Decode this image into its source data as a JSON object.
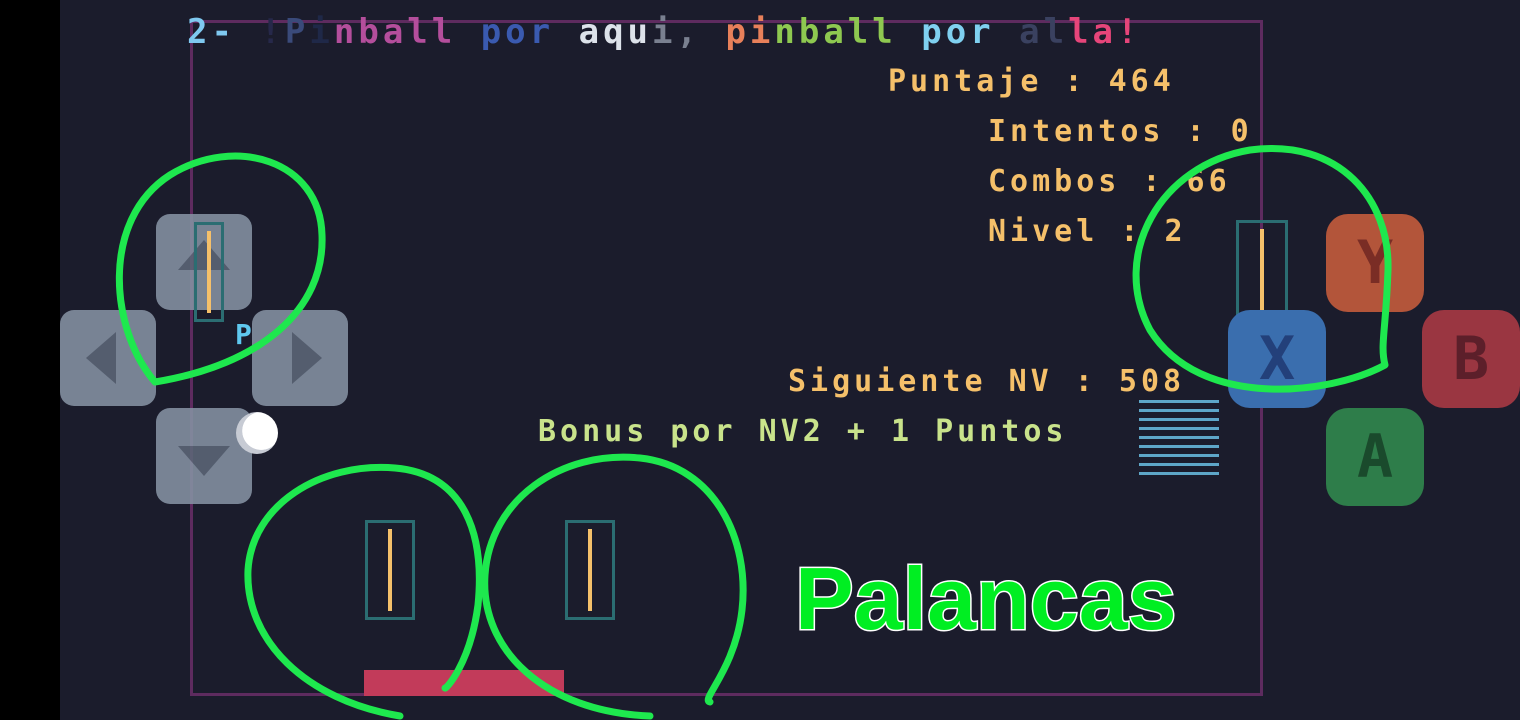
{
  "title": {
    "parts": [
      {
        "text": "2- ",
        "color": "#7fc8f0"
      },
      {
        "text": "!",
        "color": "#26284a"
      },
      {
        "text": "P",
        "color": "#3a4a7a"
      },
      {
        "text": "i",
        "color": "#1f2848"
      },
      {
        "text": "nball ",
        "color": "#b44e9c"
      },
      {
        "text": "por ",
        "color": "#3a5ab0"
      },
      {
        "text": "aqu",
        "color": "#dde2ea"
      },
      {
        "text": "i, ",
        "color": "#7a8090"
      },
      {
        "text": "pi",
        "color": "#e8805a"
      },
      {
        "text": "nball ",
        "color": "#8ec850"
      },
      {
        "text": "por ",
        "color": "#7fd0f0"
      },
      {
        "text": "al",
        "color": "#3a4160"
      },
      {
        "text": "la!",
        "color": "#e6457a"
      }
    ]
  },
  "hud": {
    "score": "Puntaje : 464",
    "attempts": "Intentos : 0",
    "combos": "Combos : 66",
    "level": "Nivel : 2",
    "next_level": "Siguiente NV : 508",
    "bonus": "Bonus por NV2 + 1 Puntos"
  },
  "dpad_label": "P",
  "buttons": {
    "y": {
      "label": "Y",
      "color": "#b3553a",
      "text_color": "#7a2d25"
    },
    "x": {
      "label": "X",
      "color": "#3a6eae",
      "text_color": "#23407a"
    },
    "b": {
      "label": "B",
      "color": "#9a3641",
      "text_color": "#5c1f2a"
    },
    "a": {
      "label": "A",
      "color": "#2e7d4a",
      "text_color": "#1a4a2c"
    }
  },
  "annotation": {
    "text": "Palancas",
    "color": "#00ee22"
  }
}
